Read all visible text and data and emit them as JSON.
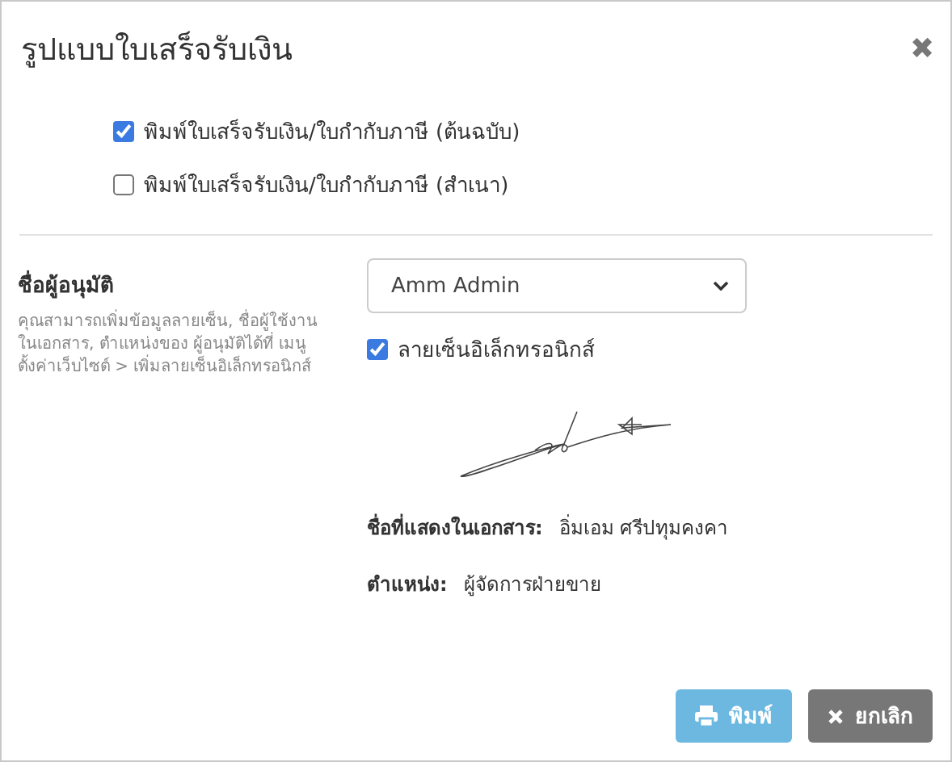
{
  "dialog": {
    "title": "รูปแบบใบเสร็จรับเงิน",
    "close": "✖"
  },
  "print_options": [
    {
      "label": "พิมพ์ใบเสร็จรับเงิน/ใบกำกับภาษี (ต้นฉบับ)",
      "checked": true
    },
    {
      "label": "พิมพ์ใบเสร็จรับเงิน/ใบกำกับภาษี (สำเนา)",
      "checked": false
    }
  ],
  "approver": {
    "heading": "ชื่อผู้อนุมัติ",
    "help": "คุณสามารถเพิ่มข้อมูลลายเซ็น, ชื่อผู้ใช้งานในเอกสาร, ตำแหน่งของ ผู้อนุมัติได้ที่ เมนู ตั้งค่าเว็บไซต์ > เพิ่มลายเซ็นอิเล็กทรอนิกส์",
    "select_value": "Amm Admin",
    "e_signature": {
      "label": "ลายเซ็นอิเล็กทรอนิกส์",
      "checked": true
    },
    "details": [
      {
        "label": "ชื่อที่แสดงในเอกสาร:",
        "value": "อิ่มเอม ศรีปทุมคงคา"
      },
      {
        "label": "ตำแหน่ง:",
        "value": "ผู้จัดการฝ่ายขาย"
      }
    ]
  },
  "buttons": [
    {
      "kind": "print",
      "label": "พิมพ์",
      "disabled": true
    },
    {
      "kind": "cancel",
      "label": "ยกเลิก",
      "disabled": false
    }
  ]
}
